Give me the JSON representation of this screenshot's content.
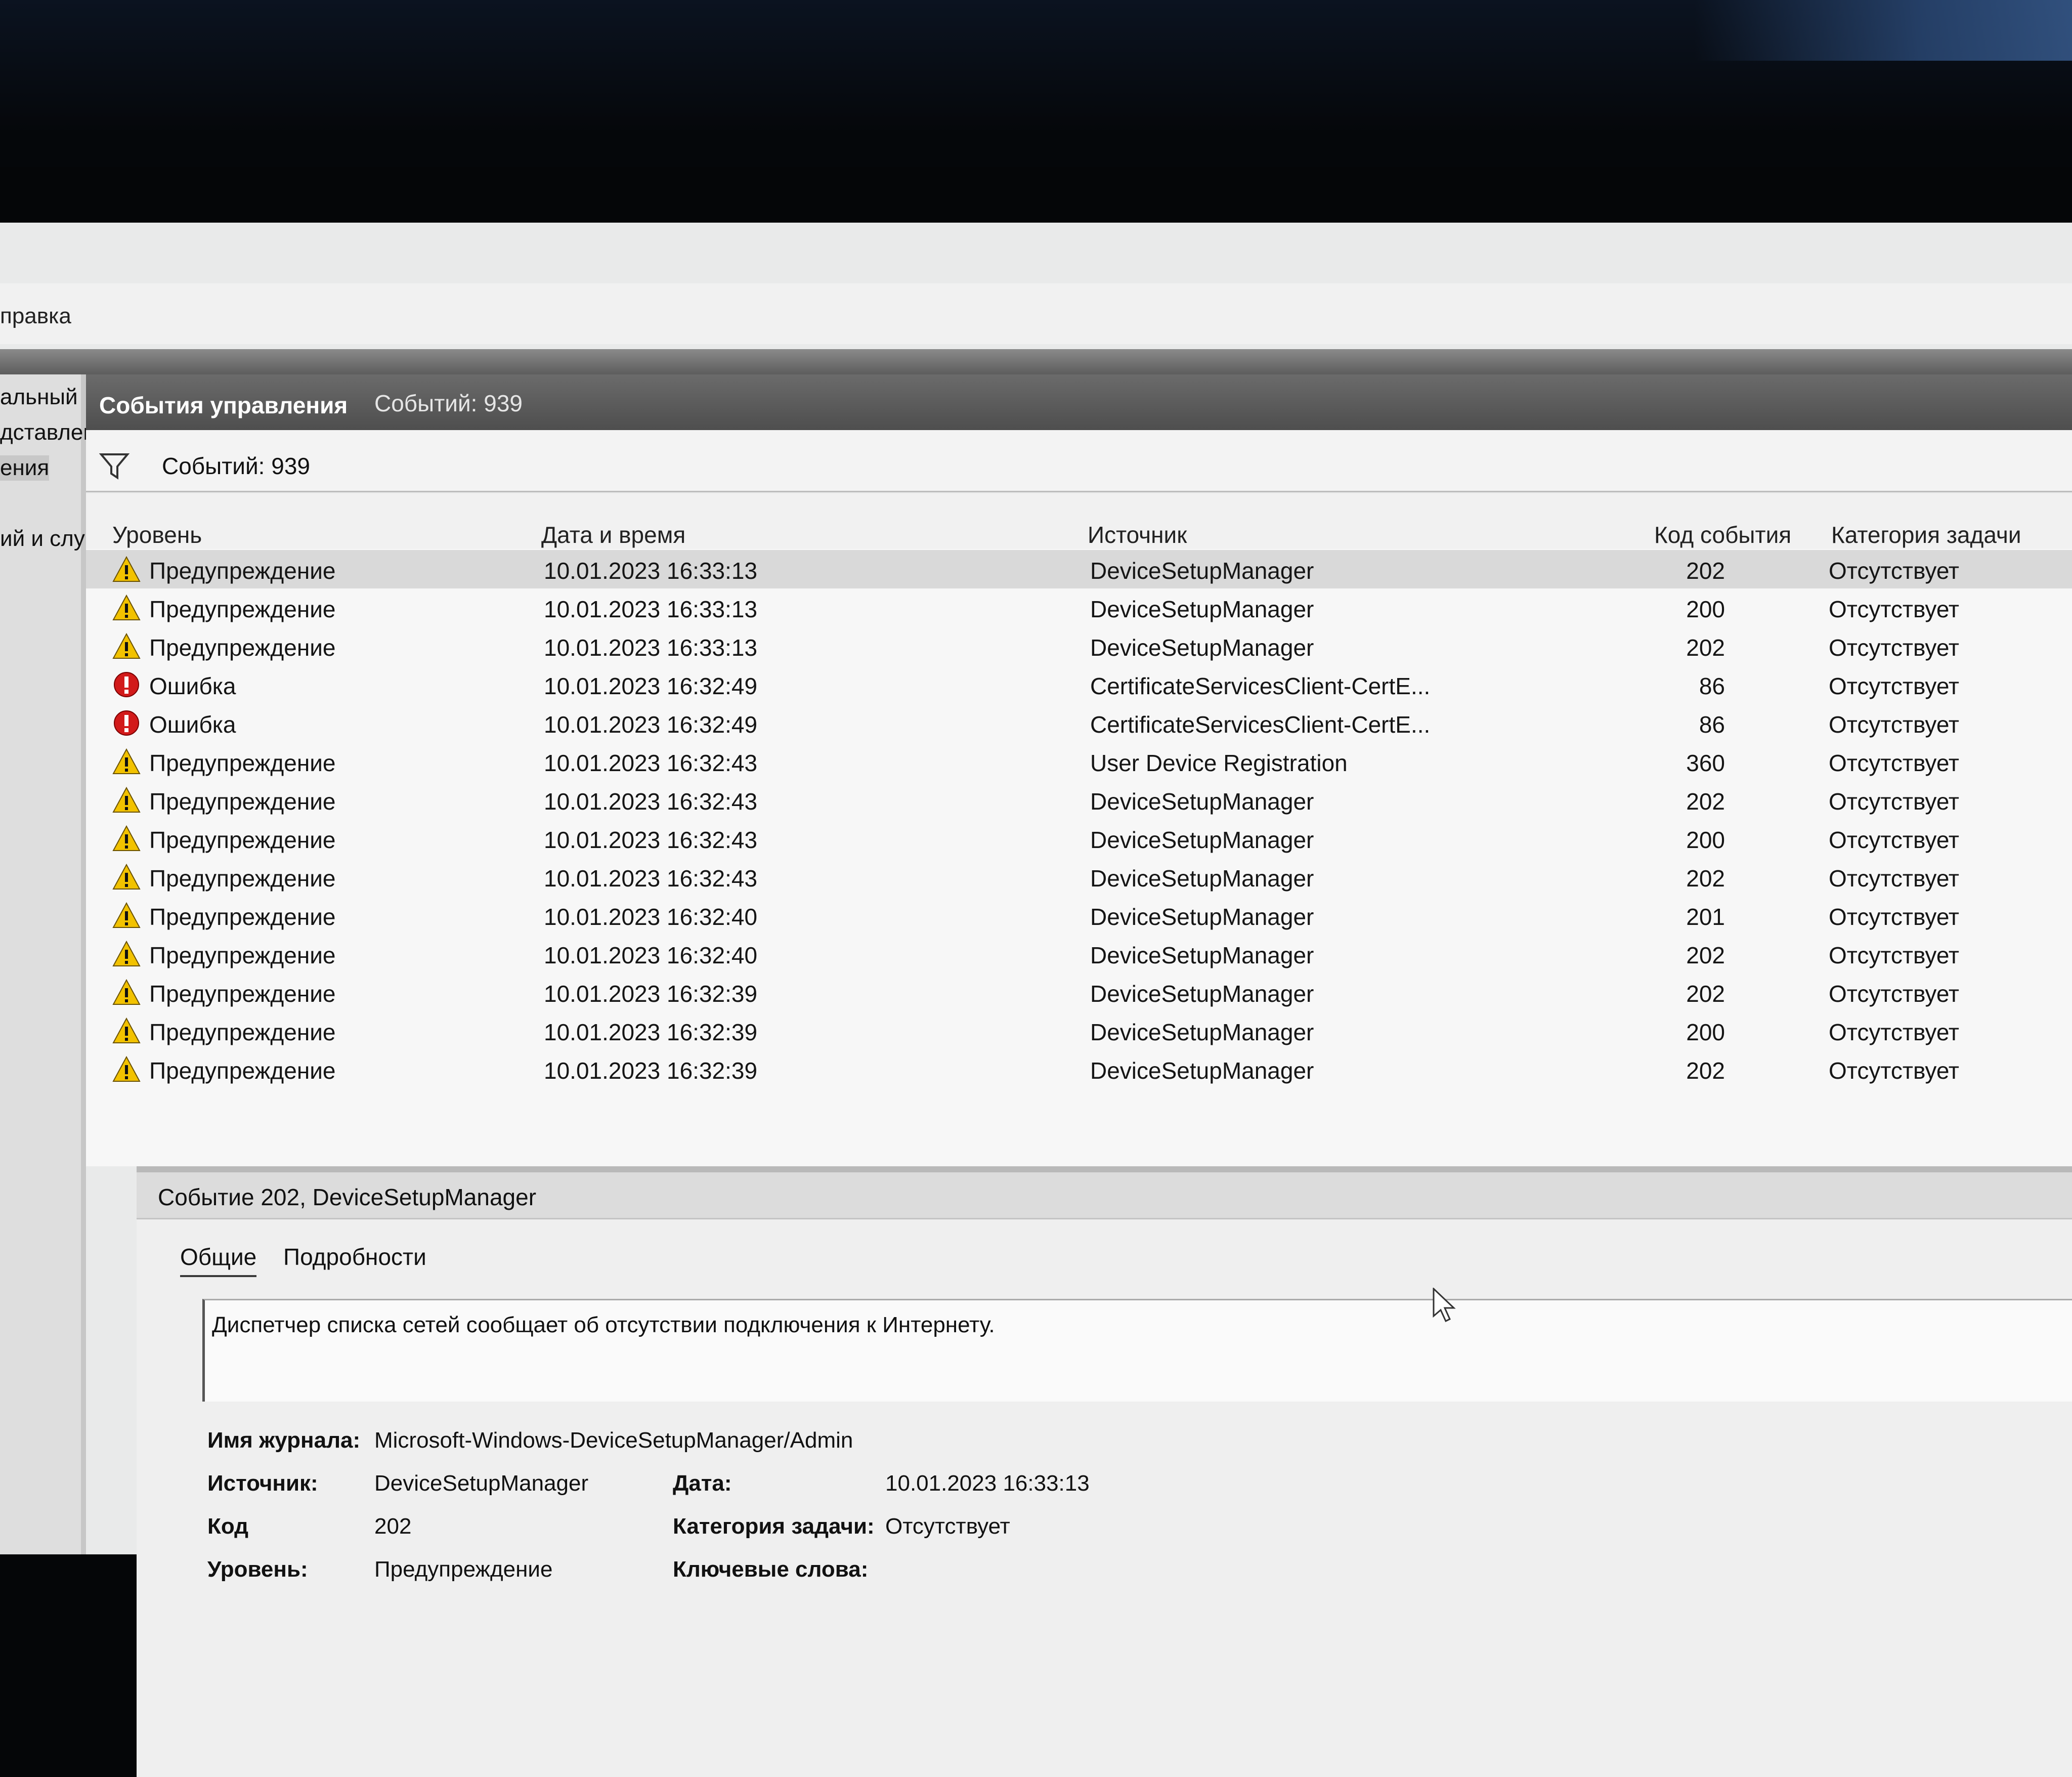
{
  "menu": {
    "item": "правка"
  },
  "left_pane": {
    "items": [
      "альный",
      "дставлен",
      "ения",
      "ий и слу"
    ]
  },
  "panel": {
    "title": "События управления",
    "count": "Событий: 939"
  },
  "filter": {
    "count": "Событий: 939"
  },
  "columns": {
    "level": "Уровень",
    "datetime": "Дата и время",
    "source": "Источник",
    "event_code": "Код события",
    "task_category": "Категория задачи"
  },
  "rows": [
    {
      "level": "Предупреждение",
      "type": "warning",
      "datetime": "10.01.2023 16:33:13",
      "source": "DeviceSetupManager",
      "code": "202",
      "category": "Отсутствует"
    },
    {
      "level": "Предупреждение",
      "type": "warning",
      "datetime": "10.01.2023 16:33:13",
      "source": "DeviceSetupManager",
      "code": "200",
      "category": "Отсутствует"
    },
    {
      "level": "Предупреждение",
      "type": "warning",
      "datetime": "10.01.2023 16:33:13",
      "source": "DeviceSetupManager",
      "code": "202",
      "category": "Отсутствует"
    },
    {
      "level": "Ошибка",
      "type": "error",
      "datetime": "10.01.2023 16:32:49",
      "source": "CertificateServicesClient-CertE...",
      "code": "86",
      "category": "Отсутствует"
    },
    {
      "level": "Ошибка",
      "type": "error",
      "datetime": "10.01.2023 16:32:49",
      "source": "CertificateServicesClient-CertE...",
      "code": "86",
      "category": "Отсутствует"
    },
    {
      "level": "Предупреждение",
      "type": "warning",
      "datetime": "10.01.2023 16:32:43",
      "source": "User Device Registration",
      "code": "360",
      "category": "Отсутствует"
    },
    {
      "level": "Предупреждение",
      "type": "warning",
      "datetime": "10.01.2023 16:32:43",
      "source": "DeviceSetupManager",
      "code": "202",
      "category": "Отсутствует"
    },
    {
      "level": "Предупреждение",
      "type": "warning",
      "datetime": "10.01.2023 16:32:43",
      "source": "DeviceSetupManager",
      "code": "200",
      "category": "Отсутствует"
    },
    {
      "level": "Предупреждение",
      "type": "warning",
      "datetime": "10.01.2023 16:32:43",
      "source": "DeviceSetupManager",
      "code": "202",
      "category": "Отсутствует"
    },
    {
      "level": "Предупреждение",
      "type": "warning",
      "datetime": "10.01.2023 16:32:40",
      "source": "DeviceSetupManager",
      "code": "201",
      "category": "Отсутствует"
    },
    {
      "level": "Предупреждение",
      "type": "warning",
      "datetime": "10.01.2023 16:32:40",
      "source": "DeviceSetupManager",
      "code": "202",
      "category": "Отсутствует"
    },
    {
      "level": "Предупреждение",
      "type": "warning",
      "datetime": "10.01.2023 16:32:39",
      "source": "DeviceSetupManager",
      "code": "202",
      "category": "Отсутствует"
    },
    {
      "level": "Предупреждение",
      "type": "warning",
      "datetime": "10.01.2023 16:32:39",
      "source": "DeviceSetupManager",
      "code": "200",
      "category": "Отсутствует"
    },
    {
      "level": "Предупреждение",
      "type": "warning",
      "datetime": "10.01.2023 16:32:39",
      "source": "DeviceSetupManager",
      "code": "202",
      "category": "Отсутствует"
    }
  ],
  "details": {
    "header": "Событие 202, DeviceSetupManager",
    "tabs": [
      "Общие",
      "Подробности"
    ],
    "description": "Диспетчер списка сетей сообщает об отсутствии подключения к Интернету.",
    "props": {
      "log_name_label": "Имя журнала:",
      "log_name": "Microsoft-Windows-DeviceSetupManager/Admin",
      "source_label": "Источник:",
      "source": "DeviceSetupManager",
      "date_label": "Дата:",
      "date": "10.01.2023 16:33:13",
      "code_label": "Код",
      "code": "202",
      "task_label": "Категория задачи:",
      "task": "Отсутствует",
      "level_label": "Уровень:",
      "level": "Предупреждение",
      "keywords_label": "Ключевые слова:"
    }
  },
  "colors": {
    "warning": "#f2c200",
    "error": "#d21a1a",
    "header": "#555555"
  },
  "icons": {
    "warning": "warning-icon",
    "error": "error-icon",
    "filter": "filter-icon"
  }
}
